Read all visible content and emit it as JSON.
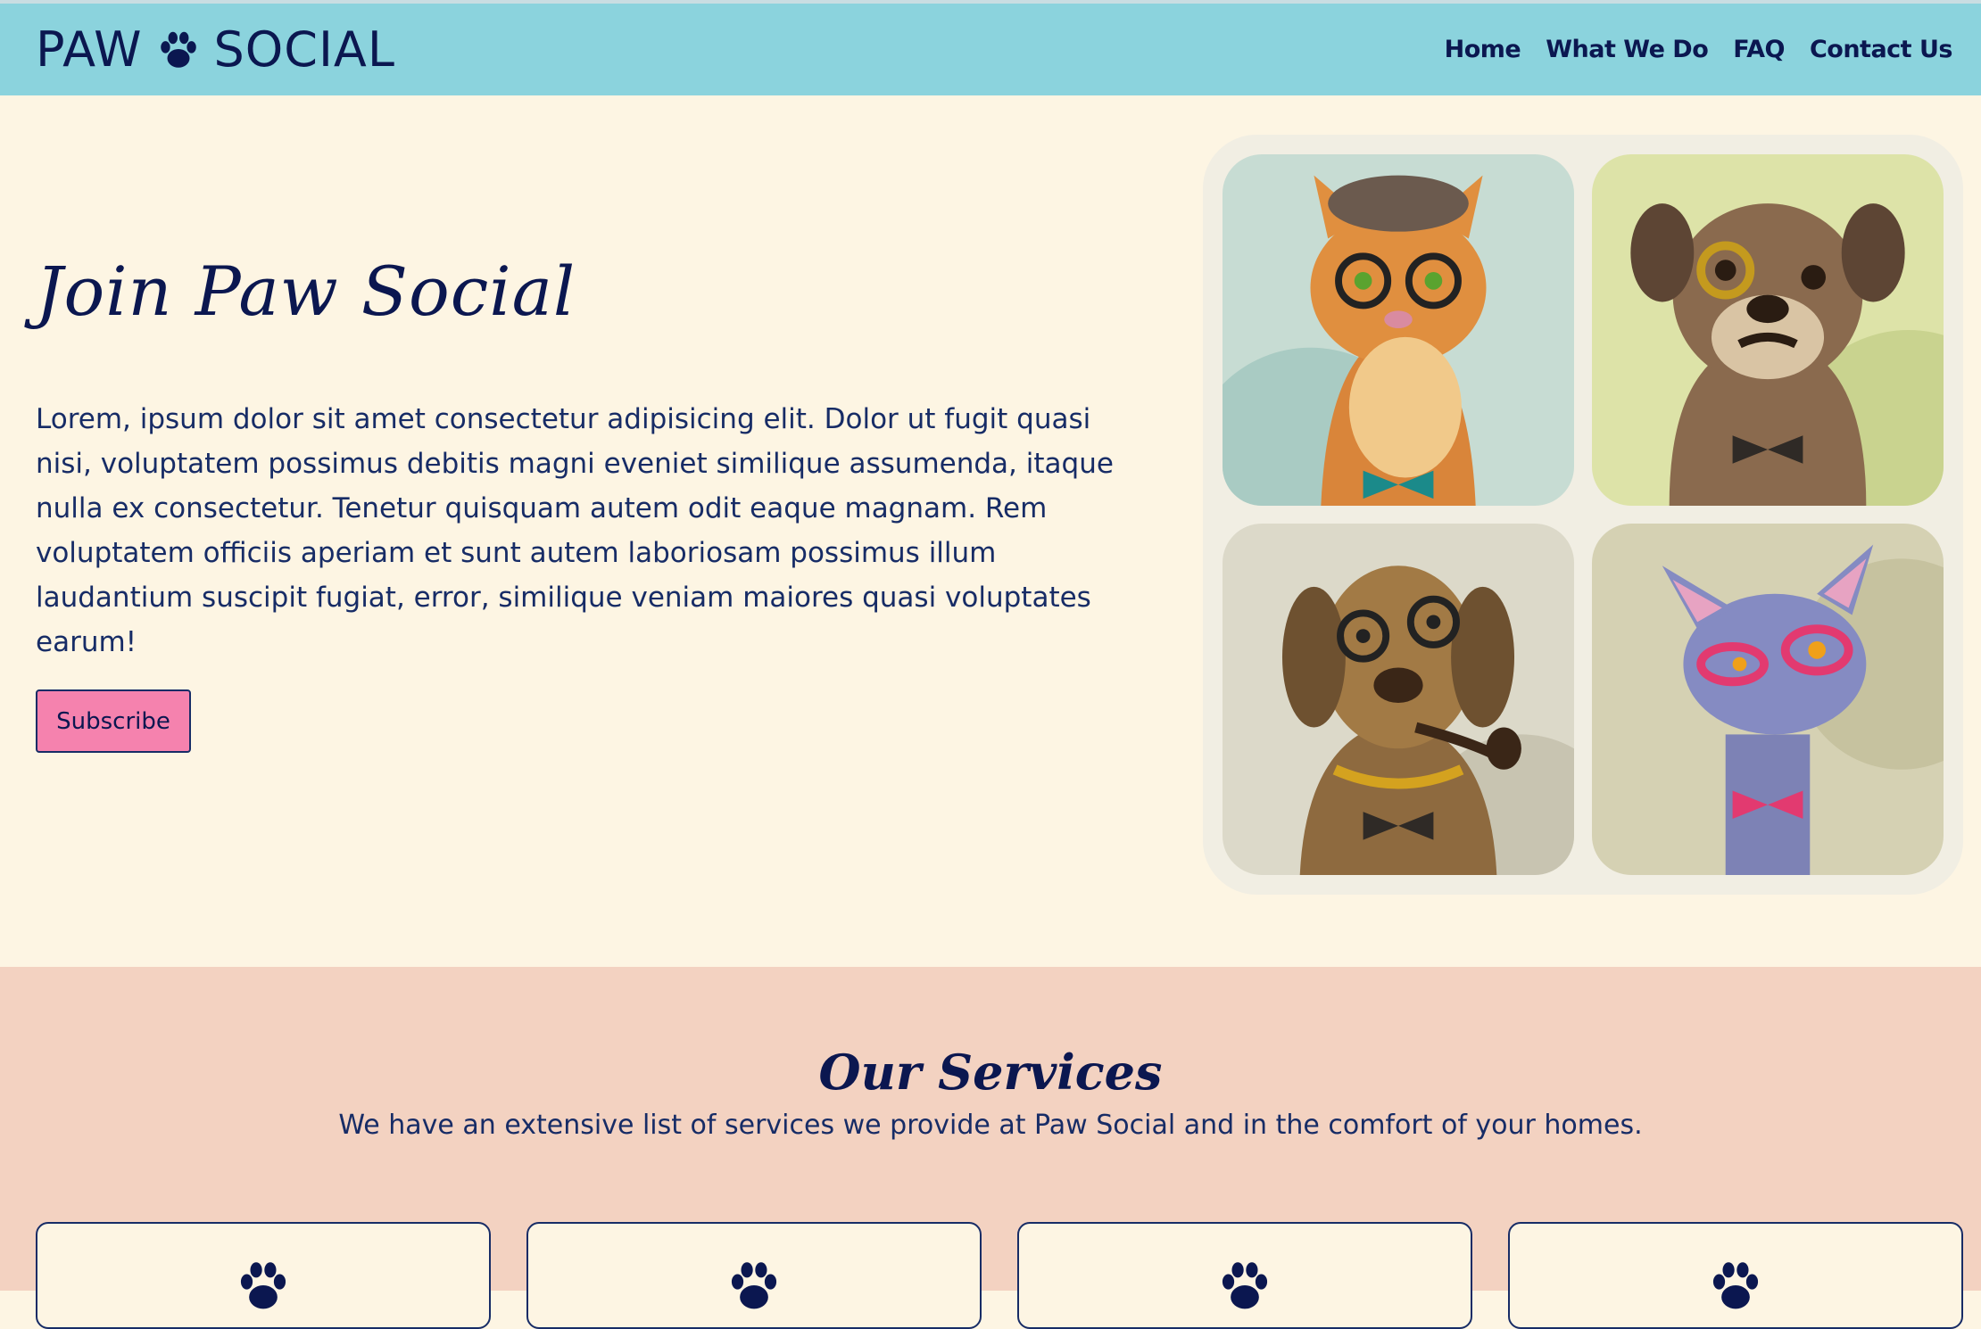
{
  "navbar": {
    "logo_left": "PAW",
    "logo_right": "SOCIAL",
    "links": [
      "Home",
      "What We Do",
      "FAQ",
      "Contact Us"
    ]
  },
  "hero": {
    "title": "Join Paw Social",
    "text": "Lorem, ipsum dolor sit amet consectetur adipisicing elit. Dolor ut fugit quasi nisi, voluptatem possimus debitis magni eveniet similique assumenda, itaque nulla ex consectetur. Tenetur quisquam autem odit eaque magnam. Rem voluptatem officiis aperiam et sunt autem laboriosam possimus illum laudantium suscipit fugiat, error, similique veniam maiores quasi voluptates earum!",
    "subscribe_label": "Subscribe"
  },
  "services": {
    "title": "Our Services",
    "subtitle": "We have an extensive list of services we provide at Paw Social and in the comfort of your homes."
  },
  "colors": {
    "navbar": "#8bd3dd",
    "background": "#fdf5e3",
    "accent_button": "#f582ae",
    "services_bg": "#f3d2c1",
    "text": "#0b1750"
  }
}
